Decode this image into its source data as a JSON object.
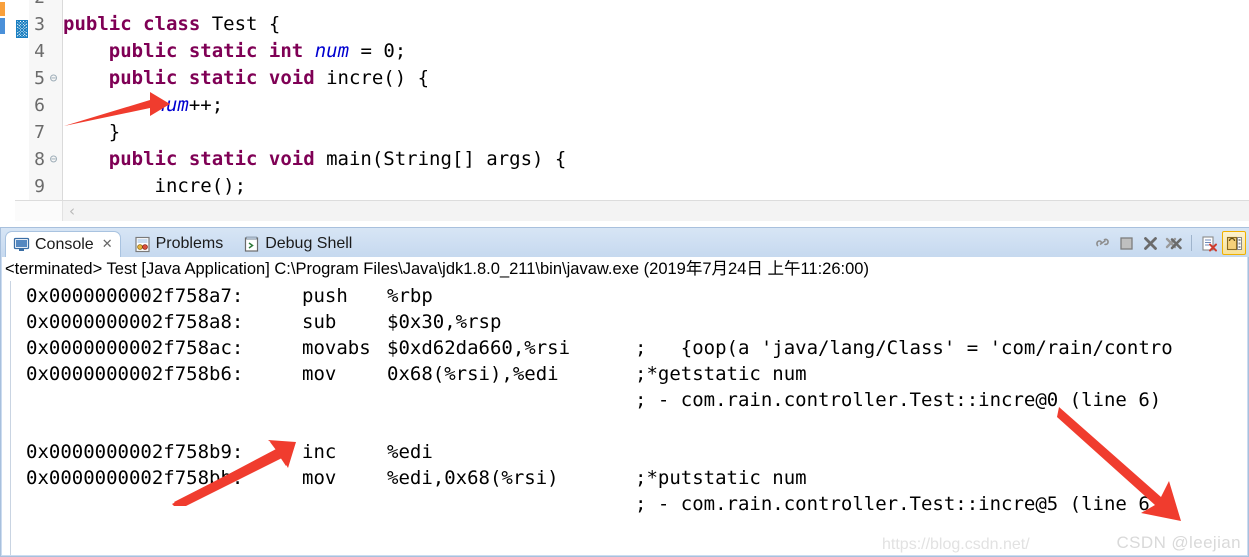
{
  "editor": {
    "lines": [
      {
        "num": "2",
        "fold": "",
        "highlight": false,
        "partial_top": true,
        "segments": []
      },
      {
        "num": "3",
        "fold": "",
        "highlight": false,
        "segments": [
          {
            "t": "kw",
            "s": "public class"
          },
          {
            "t": "pln",
            "s": " Test {"
          }
        ]
      },
      {
        "num": "4",
        "fold": "",
        "highlight": true,
        "segments": [
          {
            "t": "pln",
            "s": "    "
          },
          {
            "t": "kw",
            "s": "public static int"
          },
          {
            "t": "pln",
            "s": " "
          },
          {
            "t": "fld",
            "s": "num"
          },
          {
            "t": "pln",
            "s": " = 0;"
          }
        ]
      },
      {
        "num": "5",
        "fold": "⊖",
        "highlight": false,
        "segments": [
          {
            "t": "pln",
            "s": "    "
          },
          {
            "t": "kw",
            "s": "public static void"
          },
          {
            "t": "pln",
            "s": " incre() {"
          }
        ]
      },
      {
        "num": "6",
        "fold": "",
        "highlight": false,
        "segments": [
          {
            "t": "pln",
            "s": "        "
          },
          {
            "t": "fld",
            "s": "num"
          },
          {
            "t": "pln",
            "s": "++;"
          }
        ]
      },
      {
        "num": "7",
        "fold": "",
        "highlight": false,
        "segments": [
          {
            "t": "pln",
            "s": "    }"
          }
        ]
      },
      {
        "num": "8",
        "fold": "⊖",
        "highlight": false,
        "segments": [
          {
            "t": "pln",
            "s": "    "
          },
          {
            "t": "kw",
            "s": "public static void"
          },
          {
            "t": "pln",
            "s": " main(String[] args) {"
          }
        ]
      },
      {
        "num": "9",
        "fold": "",
        "highlight": false,
        "segments": [
          {
            "t": "pln",
            "s": "        incre();"
          }
        ]
      }
    ],
    "scroll_left_arrow": "‹"
  },
  "console_view": {
    "tabs": [
      {
        "label": "Console",
        "icon": "console-icon",
        "active": true,
        "closable": true,
        "close_glyph": "✕"
      },
      {
        "label": "Problems",
        "icon": "problems-icon",
        "active": false,
        "closable": false
      },
      {
        "label": "Debug Shell",
        "icon": "debug-shell-icon",
        "active": false,
        "closable": false
      }
    ],
    "toolbar": [
      {
        "name": "pin-console-button",
        "icon": "pin-icon"
      },
      {
        "name": "terminate-button",
        "icon": "stop-square-icon"
      },
      {
        "name": "remove-launch-button",
        "icon": "x-icon"
      },
      {
        "name": "remove-all-launches-button",
        "icon": "xx-icon"
      },
      {
        "name": "clear-console-button",
        "icon": "clear-console-icon"
      },
      {
        "name": "scroll-lock-button",
        "icon": "scroll-lock-icon",
        "active": true
      }
    ],
    "status_line": "<terminated> Test [Java Application] C:\\Program Files\\Java\\jdk1.8.0_211\\bin\\javaw.exe (2019年7月24日 上午11:26:00)",
    "output_rows": [
      {
        "addr": "0x0000000002f758a7:",
        "mnemonic": "push",
        "operands": "%rbp",
        "comment": ""
      },
      {
        "addr": "0x0000000002f758a8:",
        "mnemonic": "sub",
        "operands": "$0x30,%rsp",
        "comment": ""
      },
      {
        "addr": "0x0000000002f758ac:",
        "mnemonic": "movabs",
        "operands": "$0xd62da660,%rsi",
        "comment": ";   {oop(a 'java/lang/Class' = 'com/rain/contro"
      },
      {
        "addr": "0x0000000002f758b6:",
        "mnemonic": "mov",
        "operands": "0x68(%rsi),%edi",
        "comment": ";*getstatic num"
      },
      {
        "addr": "",
        "mnemonic": "",
        "operands": "",
        "comment": "; - com.rain.controller.Test::incre@0 (line 6)"
      },
      {
        "addr": "",
        "mnemonic": "",
        "operands": "",
        "comment": ""
      },
      {
        "addr": "0x0000000002f758b9:",
        "mnemonic": "inc",
        "operands": "%edi",
        "comment": ""
      },
      {
        "addr": "0x0000000002f758bb:",
        "mnemonic": "mov",
        "operands": "%edi,0x68(%rsi)",
        "comment": ";*putstatic num"
      },
      {
        "addr": "",
        "mnemonic": "",
        "operands": "",
        "comment": "; - com.rain.controller.Test::incre@5 (line 6)"
      }
    ],
    "watermark": "CSDN @leejian",
    "watermark_url": "https://blog.csdn.net/"
  },
  "colors": {
    "keyword": "#7f0055",
    "field": "#0000d0",
    "line_highlight": "#e7effb",
    "tab_bg": "#c6d9ef",
    "arrow_red": "#f03c2e"
  }
}
